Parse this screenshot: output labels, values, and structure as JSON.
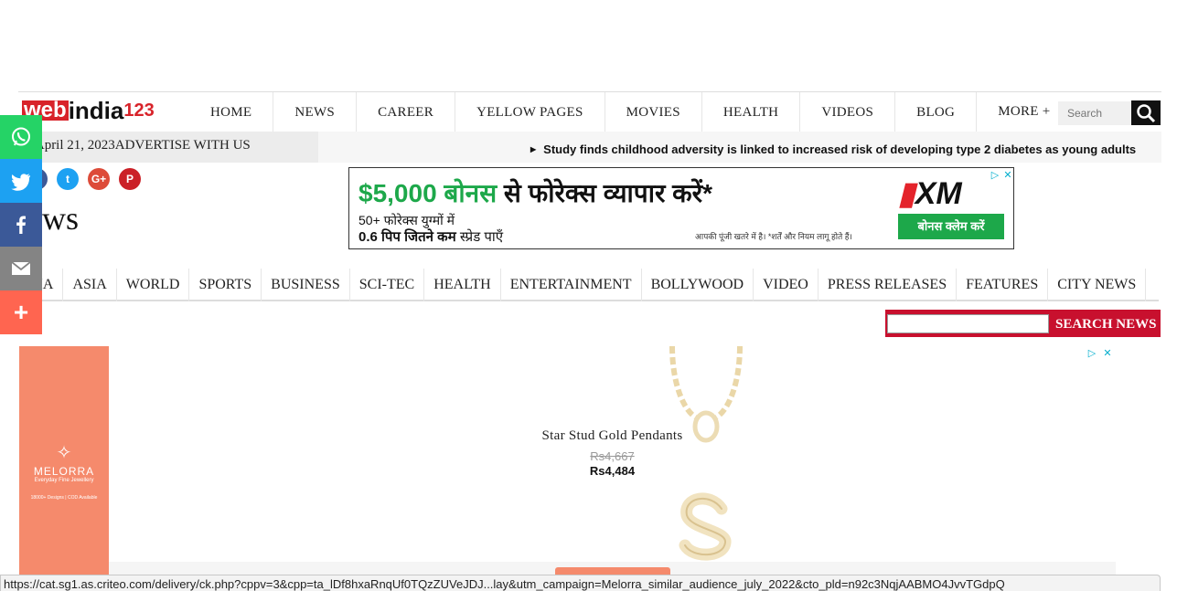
{
  "site": {
    "logo_web": "web",
    "logo_india": "india",
    "logo_num": "123"
  },
  "topnav": {
    "items": [
      "HOME",
      "NEWS",
      "CAREER",
      "YELLOW PAGES",
      "MOVIES",
      "HEALTH",
      "VIDEOS",
      "BLOG",
      "MORE +"
    ],
    "search_placeholder": "Search",
    "search_icon": "search-icon"
  },
  "datebar": {
    "date_text": "ay, April 21, 2023",
    "advertise": "ADVERTISE WITH US",
    "ticker": "Study finds childhood adversity is linked to increased risk of developing type 2 diabetes as young adults"
  },
  "social": {
    "facebook": "f",
    "twitter": "t",
    "googleplus": "G+",
    "pinterest": "P"
  },
  "page": {
    "title": "ews"
  },
  "ad_forex": {
    "headline_amount": "$5,000 बोनस",
    "headline_rest": " से फोरेक्स व्यापार करें*",
    "line2": "50+ फोरेक्स युग्मों में",
    "line3_bold": "0.6 पिप जितने कम",
    "line3_rest": " स्प्रेड पाएँ",
    "disclaimer": "आपकी पूंजी खतरे में है। *शर्तें और नियम लागू होते हैं।",
    "logo": "XM",
    "cta": "बोनस क्लेम करें"
  },
  "secnav": {
    "items": [
      "DIA",
      "ASIA",
      "WORLD",
      "SPORTS",
      "BUSINESS",
      "SCI-TEC",
      "HEALTH",
      "ENTERTAINMENT",
      "BOLLYWOOD",
      "VIDEO",
      "PRESS RELEASES",
      "FEATURES",
      "CITY NEWS"
    ]
  },
  "news_search": {
    "button": "SEARCH NEWS"
  },
  "ad_jewel": {
    "brand": "MELORRA",
    "tagline": "Everyday Fine Jewellery",
    "stats": "18000+ Designs   |   COD Available",
    "product_title": "Star Stud Gold Pendants",
    "old_price": "Rs4,667",
    "price": "Rs4,484"
  },
  "share_bar": {
    "more": "+",
    "icons": [
      "whatsapp-icon",
      "twitter-icon",
      "facebook-icon",
      "email-icon",
      "more-icon"
    ]
  },
  "status_url": "https://cat.sg1.as.criteo.com/delivery/ck.php?cppv=3&cpp=ta_lDf8hxaRnqUf0TQzZUVeJDJ...lay&utm_campaign=Melorra_similar_audience_july_2022&cto_pld=n92c3NqjAABMO4JvvTGdpQ",
  "colors": {
    "brand_red": "#d8232a",
    "nav_red": "#c8102e",
    "forex_green": "#1da84a",
    "melorra_peach": "#f58a6c"
  }
}
